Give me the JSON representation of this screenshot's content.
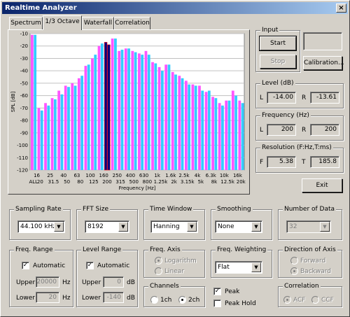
{
  "window": {
    "title": "Realtime Analyzer",
    "close_glyph": "×"
  },
  "tabs": [
    {
      "label": "Spectrum"
    },
    {
      "label": "1/3 Octave",
      "active": true
    },
    {
      "label": "Waterfall"
    },
    {
      "label": "Correlation"
    }
  ],
  "chart_data": {
    "type": "bar",
    "ylabel": "SPL [dB]",
    "xlabel": "Frequency  [Hz]",
    "ylim": [
      -120,
      -10
    ],
    "yticks": [
      -10,
      -20,
      -30,
      -40,
      -50,
      -60,
      -70,
      -80,
      -90,
      -100,
      -110,
      -120
    ],
    "grid": true,
    "categories": [
      "ALL",
      "20",
      "25",
      "31.5",
      "40",
      "50",
      "63",
      "80",
      "100",
      "125",
      "160",
      "200",
      "250",
      "315",
      "400",
      "500",
      "630",
      "800",
      "1k",
      "1.25k",
      "1.6k",
      "2k",
      "2.5k",
      "3.15k",
      "4k",
      "5k",
      "6.3k",
      "8k",
      "10k",
      "12.5k",
      "16k",
      "20k"
    ],
    "x_tick_labels_top": [
      "16",
      "",
      "40",
      "",
      "100",
      "",
      "250",
      "",
      "630",
      "",
      "1.6k",
      "",
      "4k",
      "",
      "10k",
      "",
      "",
      ""
    ],
    "x_tick_labels_row1": [
      "16",
      "25",
      "40",
      "63",
      "100",
      "160",
      "250",
      "400",
      "630",
      "1k",
      "1.6k",
      "2.5k",
      "4k",
      "6.3k",
      "10k",
      "16k"
    ],
    "x_tick_labels_row2": [
      "ALL",
      "20",
      "31.5",
      "50",
      "80",
      "125",
      "200",
      "315",
      "500",
      "800",
      "1.25k",
      "2k",
      "3.15k",
      "5k",
      "8k",
      "12.5k",
      "20k"
    ],
    "series": [
      {
        "name": "L",
        "color": "#ff55ff",
        "values": [
          -11,
          -70,
          -66,
          -62,
          -56,
          -52,
          -50,
          -46,
          -36,
          -30,
          -20,
          -17,
          -14,
          -24,
          -22,
          -24,
          -26,
          -24,
          -33,
          -37,
          -35,
          -41,
          -44,
          -48,
          -51,
          -52,
          -57,
          -61,
          -66,
          -64,
          -56,
          -64
        ]
      },
      {
        "name": "R",
        "color": "#33ccff",
        "values": [
          -11,
          -72,
          -68,
          -63,
          -59,
          -53,
          -52,
          -44,
          -35,
          -27,
          -18,
          -19,
          -14,
          -23,
          -22,
          -25,
          -27,
          -27,
          -34,
          -40,
          -35,
          -43,
          -46,
          -51,
          -52,
          -56,
          -56,
          -62,
          -68,
          -64,
          -60,
          -66
        ]
      }
    ],
    "highlight_index": 11,
    "highlight_color": "#000080",
    "highlight_edge_color": "#ff0000"
  },
  "input": {
    "label": "Input",
    "start": "Start",
    "stop": "Stop",
    "calibration": "Calibration..."
  },
  "level": {
    "label": "Level (dB)",
    "L_label": "L",
    "R_label": "R",
    "L": "-14.00",
    "R": "-13.61"
  },
  "frequency": {
    "label": "Frequency (Hz)",
    "L_label": "L",
    "R_label": "R",
    "L": "200",
    "R": "200"
  },
  "resolution": {
    "label": "Resolution (F:Hz,T:ms)",
    "F_label": "F",
    "T_label": "T",
    "F": "5.38",
    "T": "185.8"
  },
  "exit": "Exit",
  "sampling_rate": {
    "label": "Sampling Rate",
    "value": "44.100 kHz"
  },
  "fft_size": {
    "label": "FFT Size",
    "value": "8192"
  },
  "time_window": {
    "label": "Time Window",
    "value": "Hanning"
  },
  "smoothing": {
    "label": "Smoothing",
    "value": "None"
  },
  "number_of_data": {
    "label": "Number of Data",
    "value": "32"
  },
  "freq_range": {
    "label": "Freq. Range",
    "automatic": "Automatic",
    "upper_label": "Upper",
    "lower_label": "Lower",
    "upper": "20000",
    "lower": "20",
    "unit_upper": "Hz",
    "unit_lower": "Hz"
  },
  "level_range": {
    "label": "Level Range",
    "automatic": "Automatic",
    "upper_label": "Upper",
    "lower_label": "Lower",
    "upper": "0",
    "lower": "-140",
    "unit_upper": "dB",
    "unit_lower": "dB"
  },
  "freq_axis": {
    "label": "Freq. Axis",
    "opt1": "Logarithm",
    "opt2": "Linear"
  },
  "freq_weighting": {
    "label": "Freq. Weighting",
    "value": "Flat"
  },
  "direction": {
    "label": "Direction of Axis",
    "opt1": "Forward",
    "opt2": "Backward"
  },
  "channels": {
    "label": "Channels",
    "opt1": "1ch",
    "opt2": "2ch"
  },
  "peak": "Peak",
  "peak_hold": "Peak Hold",
  "correlation": {
    "label": "Correlation",
    "opt1": "ACF",
    "opt2": "CCF"
  },
  "check_glyph": "✓",
  "arrow_glyph": "▼"
}
